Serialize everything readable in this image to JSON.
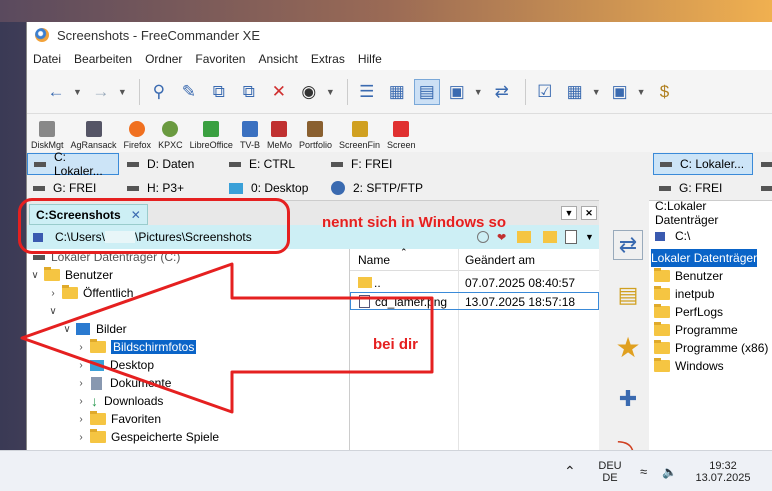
{
  "window": {
    "title": "Screenshots - FreeCommander XE"
  },
  "menu": [
    "Datei",
    "Bearbeiten",
    "Ordner",
    "Favoriten",
    "Ansicht",
    "Extras",
    "Hilfe"
  ],
  "launch_items": [
    "DiskMgt",
    "AgRansack",
    "Firefox",
    "KPXC",
    "LibreOffice",
    "TV-B",
    "MeMo",
    "Portfolio",
    "ScreenFin",
    "Screen"
  ],
  "drives_left": {
    "c": "C: Lokaler...",
    "d": "D: Daten",
    "e": "E: CTRL",
    "f": "F: FREI",
    "g": "G: FREI",
    "h": "H: P3+",
    "desktop": "0: Desktop",
    "sftp": "2: SFTP/FTP"
  },
  "left_panel": {
    "tab_label": "C:Screenshots",
    "path": "C:\\Users\\",
    "path_hidden": "",
    "path_rest": "\\Pictures\\Screenshots",
    "tree_root": "Lokaler Datenträger (C:)",
    "tree": [
      {
        "label": "Benutzer"
      },
      {
        "label": "Öffentlich"
      },
      {
        "label": ""
      },
      {
        "label": "Bilder"
      },
      {
        "label": "Bildschirmfotos"
      },
      {
        "label": "Desktop"
      },
      {
        "label": "Dokumente"
      },
      {
        "label": "Downloads"
      },
      {
        "label": "Favoriten"
      },
      {
        "label": "Gespeicherte Spiele"
      }
    ],
    "file_header": {
      "name": "Name",
      "modified": "Geändert am"
    },
    "files": [
      {
        "name": "..",
        "modified": "07.07.2025 08:40:57"
      },
      {
        "name": "cd_lamer.png",
        "modified": "13.07.2025 18:57:18"
      }
    ]
  },
  "right_panel": {
    "drive_c": "C: Lokaler...",
    "drive_g": "G: FREI",
    "title": "C:Lokaler Datenträger",
    "path": "C:\\",
    "root": "Lokaler Datenträger",
    "items": [
      "Benutzer",
      "inetpub",
      "PerfLogs",
      "Programme",
      "Programme (x86)",
      "Windows"
    ]
  },
  "annotations": {
    "windows_note": "nennt sich in Windows so",
    "your_note": "bei dir"
  },
  "taskbar": {
    "lang_top": "DEU",
    "lang_bottom": "DE",
    "time": "19:32",
    "date": "13.07.2025"
  },
  "colors": {
    "annotation": "#e52020",
    "selection": "#0a64c8",
    "tab_bg": "#cdeff5"
  }
}
